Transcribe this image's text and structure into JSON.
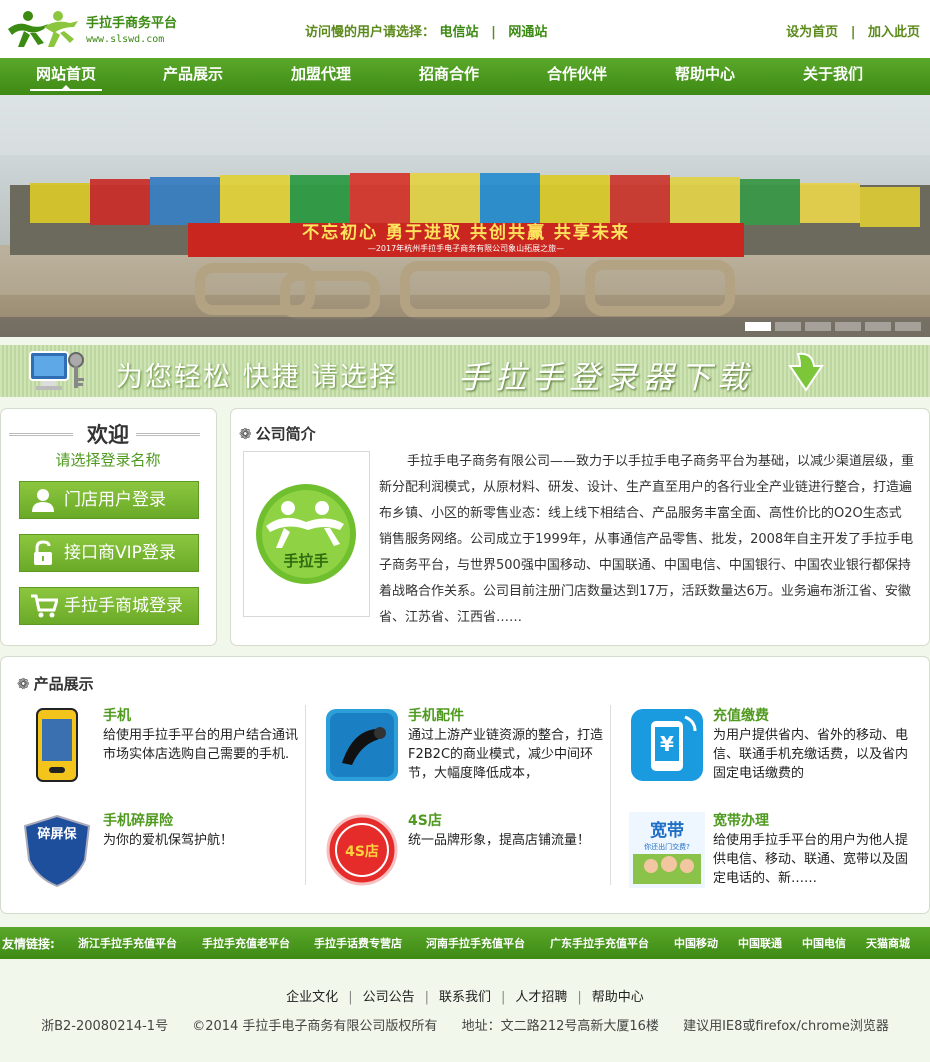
{
  "header": {
    "site_title": "手拉手商务平台",
    "site_url": "www.slswd.com",
    "mirror_prompt": "访问慢的用户请选择：",
    "mirror_telecom": "电信站",
    "mirror_netcom": "网通站",
    "set_home": "设为首页",
    "add_fav": "加入此页",
    "sep": "|"
  },
  "nav": [
    "网站首页",
    "产品展示",
    "加盟代理",
    "招商合作",
    "合作伙伴",
    "帮助中心",
    "关于我们"
  ],
  "banner": {
    "slogan": "不忘初心  勇于进取  共创共赢  共享未来",
    "caption": "—2017年杭州手拉手电子商务有限公司象山拓展之旅—",
    "slides": 6,
    "active_slide": 1
  },
  "download_band": {
    "text": "为您轻松  快捷  请选择",
    "download": "手拉手登录器下载"
  },
  "login": {
    "title": "欢迎",
    "subtitle": "请选择登录名称",
    "buttons": [
      "门店用户登录",
      "接口商VIP登录",
      "手拉手商城登录"
    ]
  },
  "intro": {
    "title": "公司简介",
    "logo_text": "手拉手",
    "text": "手拉手电子商务有限公司——致力于以手拉手电子商务平台为基础，以减少渠道层级，重新分配利润模式，从原材料、研发、设计、生产直至用户的各行业全产业链进行整合，打造遍布乡镇、小区的新零售业态：线上线下相结合、产品服务丰富全面、高性价比的O2O生态式销售服务网络。公司成立于1999年，从事通信产品零售、批发，2008年自主开发了手拉手电子商务平台，与世界500强中国移动、中国联通、中国电信、中国银行、中国农业银行都保持着战略合作关系。公司目前注册门店数量达到17万，活跃数量达6万。业务遍布浙江省、安徽省、江苏省、江西省……"
  },
  "products": {
    "title": "产品展示",
    "items": [
      {
        "name": "手机",
        "desc": "给使用手拉手平台的用户结合通讯市场实体店选购自己需要的手机."
      },
      {
        "name": "手机配件",
        "desc": "通过上游产业链资源的整合，打造F2B2C的商业模式，减少中间环节，大幅度降低成本，"
      },
      {
        "name": "充值缴费",
        "desc": "为用户提供省内、省外的移动、电信、联通手机充缴话费，以及省内固定电话缴费的"
      },
      {
        "name": "手机碎屏险",
        "desc": "为你的爱机保驾护航！"
      },
      {
        "name": "4S店",
        "desc": "统一品牌形象，提高店铺流量！"
      },
      {
        "name": "宽带办理",
        "desc": "给使用手拉手平台的用户为他人提供电信、移动、联通、宽带以及固定电话的、新……"
      }
    ],
    "icon_text": {
      "screen": "碎屏保",
      "store": "4S店",
      "broadband": "宽带",
      "broadband_sub": "你还出门交费?"
    }
  },
  "friends": {
    "label": "友情链接:",
    "links": [
      "浙江手拉手充值平台",
      "手拉手充值老平台",
      "手拉手话费专营店",
      "河南手拉手充值平台",
      "广东手拉手充值平台",
      "中国移动",
      "中国联通",
      "中国电信",
      "天猫商城"
    ]
  },
  "footer": {
    "links": [
      "企业文化",
      "公司公告",
      "联系我们",
      "人才招聘",
      "帮助中心"
    ],
    "icp": "浙B2-20080214-1号",
    "copyright": "©2014 手拉手电子商务有限公司版权所有",
    "address": "地址：文二路212号高新大厦16楼",
    "browser": "建议用IE8或firefox/chrome浏览器"
  },
  "colors": {
    "brand_green": "#4f9a1f",
    "nav_green": "#4a9a1f",
    "button_green": "#7ab833"
  }
}
